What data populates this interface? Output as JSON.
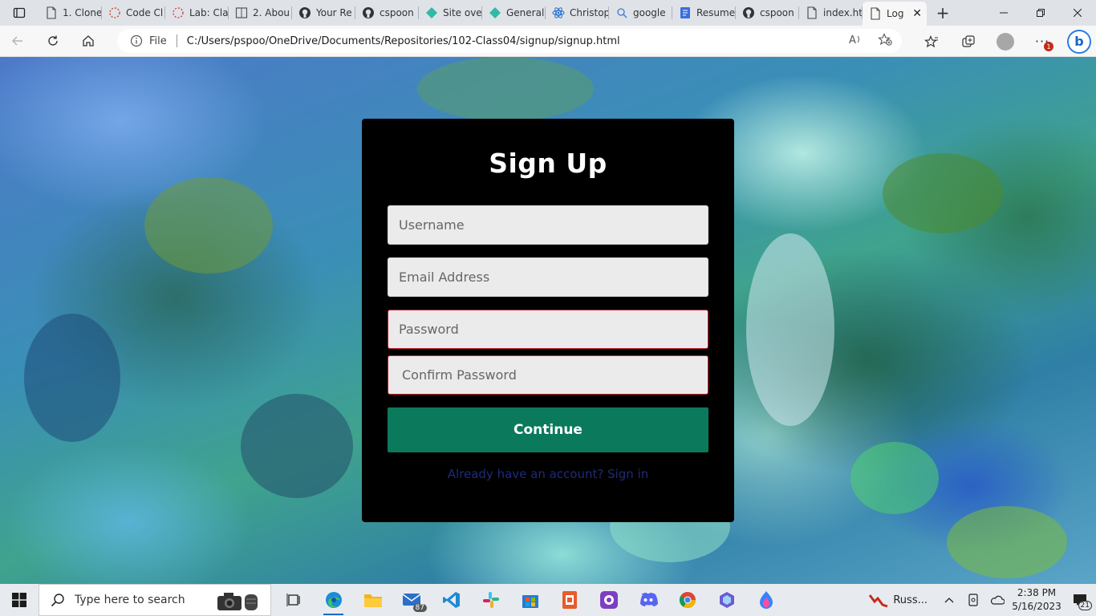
{
  "browser": {
    "tabs": [
      {
        "label": "1. Clone",
        "icon": "page-icon"
      },
      {
        "label": "Code Cl",
        "icon": "loading-icon"
      },
      {
        "label": "Lab: Cla",
        "icon": "loading-icon"
      },
      {
        "label": "2. Abou",
        "icon": "book-icon"
      },
      {
        "label": "Your Re",
        "icon": "github-icon"
      },
      {
        "label": "cspoon",
        "icon": "github-icon"
      },
      {
        "label": "Site ove",
        "icon": "netlify-icon"
      },
      {
        "label": "General",
        "icon": "netlify-icon"
      },
      {
        "label": "Christop",
        "icon": "react-icon"
      },
      {
        "label": "google",
        "icon": "search-icon"
      },
      {
        "label": "Resume",
        "icon": "docs-icon"
      },
      {
        "label": "cspoon",
        "icon": "github-icon"
      },
      {
        "label": "index.ht",
        "icon": "page-icon"
      },
      {
        "label": "Log",
        "icon": "page-icon",
        "active": true
      }
    ],
    "address": {
      "scheme_label": "File",
      "url": "C:/Users/pspoo/OneDrive/Documents/Repositories/102-Class04/signup/signup.html"
    },
    "menu_badge": "1"
  },
  "page": {
    "title": "Sign Up",
    "fields": {
      "username": "Username",
      "email": "Email Address",
      "password": "Password",
      "confirm": "Confirm Password"
    },
    "continue_label": "Continue",
    "signin_link": "Already have an account? Sign in"
  },
  "taskbar": {
    "search_placeholder": "Type here to search",
    "mail_badge": "87",
    "weather_label": "Russ...",
    "time": "2:38 PM",
    "date": "5/16/2023",
    "notification_count": "21"
  },
  "colors": {
    "card_bg": "#000000",
    "continue_bg": "#0b7a5c",
    "invalid_border": "#c81f2c",
    "link": "#1f2a7a"
  }
}
